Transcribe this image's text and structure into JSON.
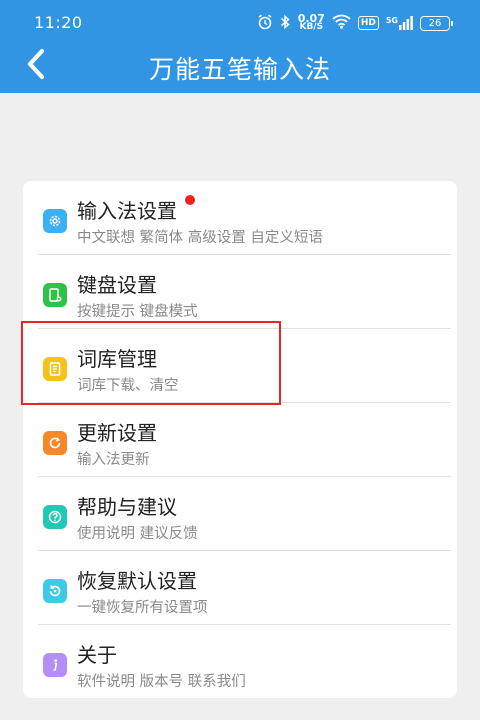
{
  "status_bar": {
    "time": "11:20",
    "net_speed_value": "0.07",
    "net_speed_unit": "KB/S",
    "hd_label": "HD",
    "signal_label": "5G",
    "battery": "26"
  },
  "header": {
    "title": "万能五笔输入法"
  },
  "menu": {
    "items": [
      {
        "title": "输入法设置",
        "subtitle": "中文联想 繁简体 高级设置 自定义短语",
        "icon": "gear-icon",
        "color": "#3ab0f5"
      },
      {
        "title": "键盘设置",
        "subtitle": "按键提示 键盘模式",
        "icon": "keyboard-settings-icon",
        "color": "#2ec24b"
      },
      {
        "title": "词库管理",
        "subtitle": "词库下载、清空",
        "icon": "dictionary-icon",
        "color": "#f5c21a"
      },
      {
        "title": "更新设置",
        "subtitle": "输入法更新",
        "icon": "update-icon",
        "color": "#f5892a"
      },
      {
        "title": "帮助与建议",
        "subtitle": "使用说明 建议反馈",
        "icon": "help-icon",
        "color": "#1fc9b6"
      },
      {
        "title": "恢复默认设置",
        "subtitle": "一键恢复所有设置项",
        "icon": "restore-icon",
        "color": "#3fc8e8"
      },
      {
        "title": "关于",
        "subtitle": "软件说明 版本号 联系我们",
        "icon": "info-icon",
        "color": "#b28ef5"
      }
    ]
  },
  "colors": {
    "header_bg": "#3295e3",
    "highlight_border": "#e8262a",
    "notification_dot": "#ef2020"
  }
}
